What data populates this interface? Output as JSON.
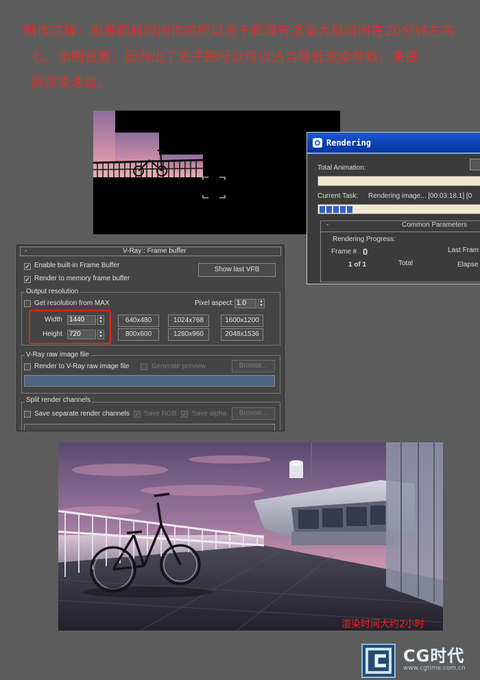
{
  "headings": {
    "line1": "制作过程：图是前段时间作的所以光子图没有渲染大概时间在20分钟左右",
    "line2": "七、出图设置：因为出了光子图所以可以适当降低渲染参数，来提",
    "line3": "高渲染速度。"
  },
  "rendering_dialog": {
    "title": "Rendering",
    "total_animation_label": "Total Animation:",
    "current_task_label": "Current Task:",
    "current_task_value": "Rendering image... [00:03:18.1] [0",
    "progress_segments": 5,
    "rollout_minus": "-",
    "common_parameters_label": "Common Parameters",
    "rendering_progress_label": "Rendering Progress:",
    "frame_label": "Frame #",
    "frame_value": "0",
    "last_frame_label": "Last Fram",
    "of_label": "1 of 1",
    "total_label": "Total",
    "elapsed_label": "Elapse"
  },
  "vray_panel": {
    "rollout_minus": "-",
    "title": "V-Ray:: Frame buffer",
    "enable_builtin_label": "Enable built-in Frame Buffer",
    "enable_builtin_checked": true,
    "render_memory_label": "Render to memory frame buffer",
    "render_memory_checked": true,
    "show_last_vfb_label": "Show last VFB",
    "output_resolution_label": "Output resolution",
    "get_resolution_label": "Get resolution from MAX",
    "get_resolution_checked": false,
    "pixel_aspect_label": "Pixel aspect:",
    "pixel_aspect_value": "1.0",
    "width_label": "Width",
    "width_value": "1440",
    "height_label": "Height",
    "height_value": "720",
    "presets": [
      "640x480",
      "1024x768",
      "1600x1200",
      "800x600",
      "1280x960",
      "2048x1536"
    ],
    "raw_image_group_label": "V-Ray raw image file",
    "render_raw_label": "Render to V-Ray raw image file",
    "generate_preview_label": "Generate preview",
    "browse_label": "Browse...",
    "split_channels_label": "Split render channels",
    "save_separate_label": "Save separate render channels",
    "save_rgb_label": "Save RGB",
    "save_alpha_label": "Save alpha",
    "browse2_label": "Browse...",
    "checkmark": "✓"
  },
  "caption": "渲染时间大约2小时",
  "logo": {
    "brand": "CG时代",
    "url": "www.cgtime.com.cn"
  }
}
